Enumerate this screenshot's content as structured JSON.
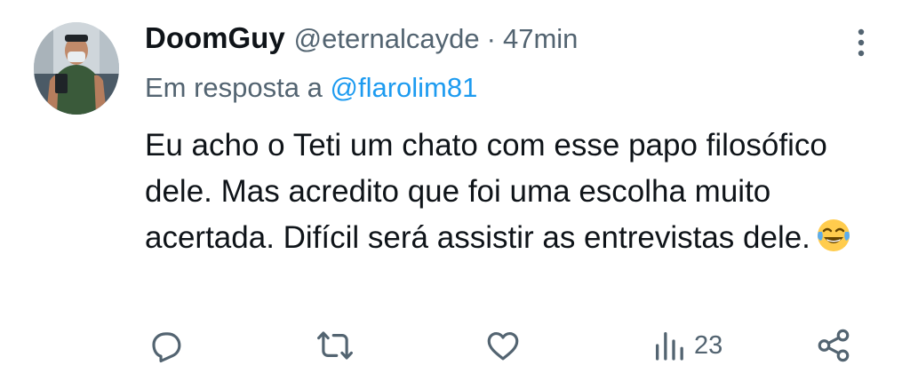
{
  "tweet": {
    "author_name": "DoomGuy",
    "author_handle": "@eternalcayde",
    "separator": "·",
    "time": "47min",
    "reply_prefix": "Em resposta a",
    "reply_mention": "@flarolim81",
    "text": "Eu acho o Teti um chato com esse papo filosófico dele. Mas acredito que foi uma escolha muito acertada. Difícil será assistir as entrevistas dele.",
    "emoji": "face-with-tears-of-joy"
  },
  "actions": {
    "reply_icon": "reply-icon",
    "retweet_icon": "retweet-icon",
    "like_icon": "heart-icon",
    "views_icon": "views-icon",
    "views_count": "23",
    "share_icon": "share-icon"
  },
  "colors": {
    "text": "#0f1419",
    "secondary": "#536471",
    "link": "#1d9bf0"
  }
}
